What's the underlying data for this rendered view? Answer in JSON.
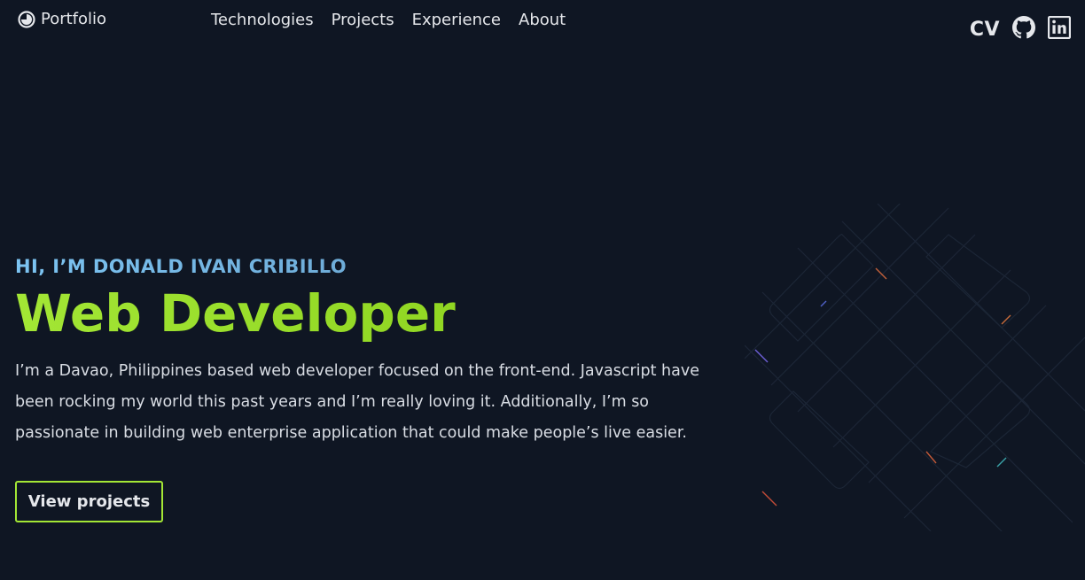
{
  "header": {
    "logo_label": "Portfolio",
    "nav": [
      {
        "label": "Technologies"
      },
      {
        "label": "Projects"
      },
      {
        "label": "Experience"
      },
      {
        "label": "About"
      }
    ],
    "socials": {
      "cv_label": "CV",
      "github_icon": "github-icon",
      "linkedin_icon": "linkedin-icon"
    }
  },
  "hero": {
    "greeting": "HI, I’M DONALD IVAN CRIBILLO",
    "title": "Web Developer",
    "intro": "I’m a Davao, Philippines based web developer focused on the front-end. Javascript have been rocking my world this past years and I’m really loving it. Additionally, I’m so passionate in building web enterprise application that could make people’s live easier.",
    "cta_label": "View projects"
  },
  "colors": {
    "background": "#0f1623",
    "accent": "#a3e635",
    "greeting_start": "#7cc4f2",
    "greeting_end": "#5e8fb8",
    "text": "#e5e7eb"
  }
}
